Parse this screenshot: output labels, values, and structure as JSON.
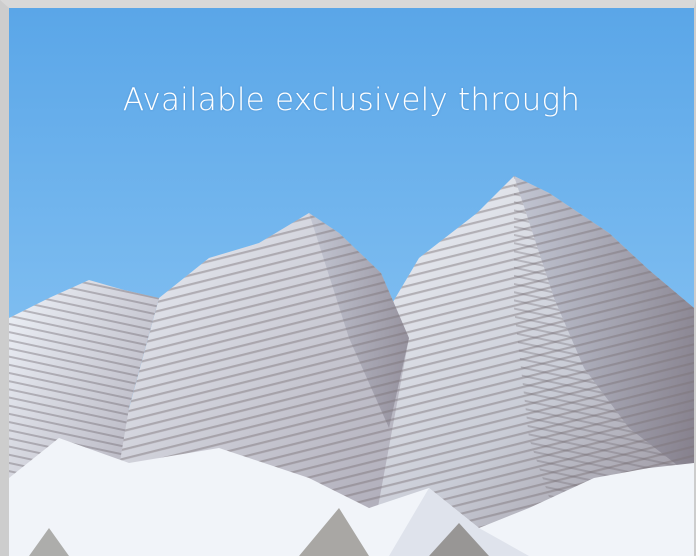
{
  "promo": {
    "headline": "Available exclusively through"
  },
  "image": {
    "subject": "snow-covered mountain peaks under a clear blue sky",
    "icon": "mountain-photo"
  },
  "colors": {
    "sky_top": "#5ea8e8",
    "sky_bottom": "#a9d3f3",
    "snow": "#f2f5fa",
    "rock": "#8a7f86",
    "text": "#ffffff"
  }
}
